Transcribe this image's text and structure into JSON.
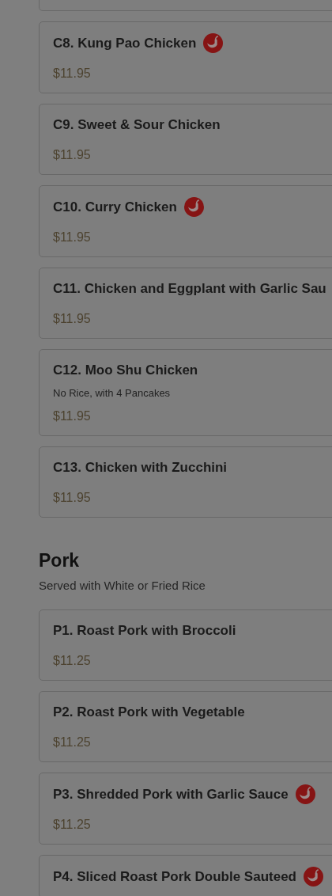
{
  "sections": [
    {
      "items": [
        {
          "kind": "partial"
        },
        {
          "kind": "dish",
          "name": "C8. Kung Pao Chicken",
          "spicy": true,
          "price": "$11.95"
        },
        {
          "kind": "dish",
          "name": "C9. Sweet & Sour Chicken",
          "spicy": false,
          "price": "$11.95"
        },
        {
          "kind": "dish",
          "name": "C10. Curry Chicken",
          "spicy": true,
          "price": "$11.95"
        },
        {
          "kind": "dish",
          "name": "C11. Chicken and Eggplant with Garlic Sau",
          "spicy": false,
          "price": "$11.95"
        },
        {
          "kind": "dish",
          "name": "C12. Moo Shu Chicken",
          "spicy": false,
          "note": "No Rice, with 4 Pancakes",
          "price": "$11.95"
        },
        {
          "kind": "dish",
          "name": "C13. Chicken with Zucchini",
          "spicy": false,
          "price": "$11.95"
        }
      ]
    },
    {
      "title": "Pork",
      "subtitle": "Served with White or Fried Rice",
      "items": [
        {
          "kind": "dish",
          "name": "P1. Roast Pork with Broccoli",
          "spicy": false,
          "price": "$11.25"
        },
        {
          "kind": "dish",
          "name": "P2. Roast Pork with Vegetable",
          "spicy": false,
          "price": "$11.25"
        },
        {
          "kind": "dish",
          "name": "P3. Shredded Pork with Garlic Sauce",
          "spicy": true,
          "price": "$11.25"
        },
        {
          "kind": "dish",
          "name": "P4. Sliced Roast Pork Double Sauteed",
          "spicy": true
        }
      ]
    }
  ]
}
